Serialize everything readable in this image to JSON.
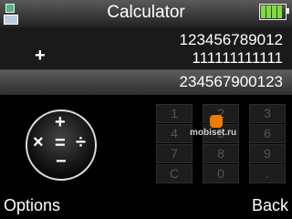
{
  "app": {
    "title": "Calculator"
  },
  "status": {
    "battery_level": 1.0,
    "battery_color": "#7edc40"
  },
  "display": {
    "operand1": "123456789012",
    "operator": "+",
    "operand2": "111111111111",
    "result": "234567900123"
  },
  "operations": {
    "plus": "+",
    "minus": "−",
    "times": "×",
    "divide": "÷",
    "equals": "="
  },
  "keypad": {
    "keys": [
      "1",
      "2",
      "3",
      "4",
      "5",
      "6",
      "7",
      "8",
      "9",
      "C",
      "0",
      "."
    ]
  },
  "watermark": "mobiset.ru",
  "softkeys": {
    "left": "Options",
    "right": "Back"
  }
}
